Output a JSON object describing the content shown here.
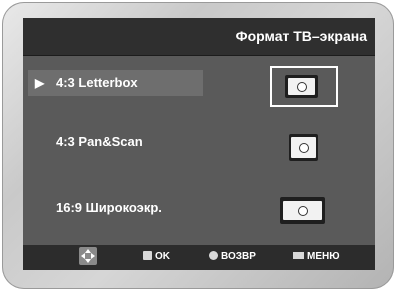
{
  "header": {
    "title": "Формат ТВ–экрана"
  },
  "options": [
    {
      "label": "4:3 Letterbox",
      "marker": "▶",
      "selected": true,
      "icon": "tv-letterbox-icon"
    },
    {
      "label": "4:3 Pan&Scan",
      "selected": false,
      "icon": "tv-panscan-icon"
    },
    {
      "label": "16:9 Широкоэкр.",
      "selected": false,
      "icon": "tv-widescreen-icon"
    }
  ],
  "footer": {
    "nav_icon": "dpad-icon",
    "ok_label": "OK",
    "back_label": "ВОЗВР",
    "menu_label": "МЕНЮ"
  },
  "colors": {
    "background": "#5a5a5a",
    "header": "#2f2f2f",
    "footer": "#2c2c2c",
    "selected_row": "#6e6e6e",
    "text": "#ffffff"
  }
}
